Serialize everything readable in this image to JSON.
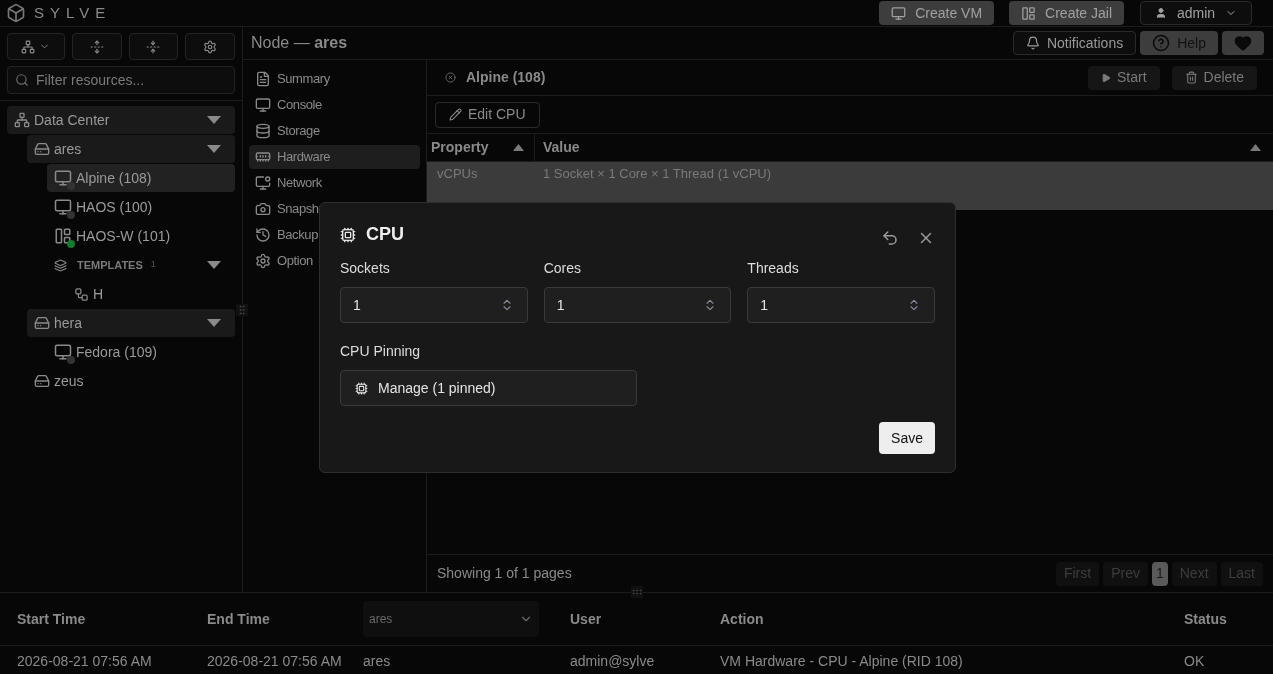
{
  "app": {
    "logo": "SYLVE"
  },
  "top_actions": [
    {
      "label": "Create VM",
      "kind": "vm"
    },
    {
      "label": "Create Jail",
      "kind": "jail"
    }
  ],
  "user_menu": {
    "label": "admin"
  },
  "sidebar": {
    "search": {
      "placeholder": "Filter resources..."
    },
    "tree": [
      {
        "label": "Data Center",
        "kind": "datacenter",
        "expanded": true,
        "children": [
          {
            "label": "ares",
            "kind": "node",
            "expanded": true,
            "children": [
              {
                "label": "Alpine (108)",
                "kind": "vm",
                "running": false,
                "selected": true
              },
              {
                "label": "HAOS (100)",
                "kind": "vm",
                "running": false,
                "selected": false
              },
              {
                "label": "HAOS-W (101)",
                "kind": "jail",
                "running": true,
                "selected": false
              },
              {
                "label": "TEMPLATES",
                "count": "1",
                "kind": "group",
                "expanded": true,
                "children": [
                  {
                    "label": "H",
                    "kind": "template"
                  }
                ]
              }
            ]
          },
          {
            "label": "hera",
            "kind": "node",
            "expanded": true,
            "children": [
              {
                "label": "Fedora (109)",
                "kind": "vm",
                "running": false,
                "selected": false
              }
            ]
          },
          {
            "label": "zeus",
            "kind": "node"
          }
        ]
      }
    ]
  },
  "header": {
    "title": "Node — **ares**"
  },
  "header_actions": [
    {
      "label": "Notifications",
      "kind": "bell"
    },
    {
      "label": "Help",
      "kind": "help"
    },
    {
      "kind": "heart"
    }
  ],
  "nav": [
    {
      "label": "Summary",
      "kind": "summary",
      "selected": false
    },
    {
      "label": "Console",
      "kind": "console",
      "selected": false
    },
    {
      "label": "Storage",
      "kind": "storage",
      "selected": false
    },
    {
      "label": "Hardware",
      "kind": "hardware",
      "selected": true
    },
    {
      "label": "Network",
      "kind": "network",
      "selected": false
    },
    {
      "label": "Snapsh",
      "kind": "snapshots",
      "selected": false
    },
    {
      "label": "Backup",
      "kind": "backups",
      "selected": false
    },
    {
      "label": "Option",
      "kind": "options",
      "selected": false
    }
  ],
  "vm_panel": {
    "title": "Alpine (108)",
    "actions": [
      {
        "label": "Start",
        "kind": "play"
      },
      {
        "label": "Delete",
        "kind": "trash"
      }
    ],
    "edit_button": "Edit CPU",
    "table": {
      "columns": [
        "Property",
        "Value"
      ],
      "rows": [
        {
          "cells": [
            "vCPUs",
            "1 Socket × 1 Core × 1 Thread (1 vCPU)"
          ],
          "selected": true
        },
        {
          "cells": [],
          "selected": true
        }
      ]
    },
    "pagination": {
      "summary": "Showing 1 of 1 pages",
      "buttons": [
        {
          "label": "First",
          "selected": false,
          "disabled": true
        },
        {
          "label": "Prev",
          "selected": false,
          "disabled": true
        },
        {
          "label": "1",
          "selected": true,
          "disabled": false
        },
        {
          "label": "Next",
          "selected": false,
          "disabled": true
        },
        {
          "label": "Last",
          "selected": false,
          "disabled": true
        }
      ]
    }
  },
  "dialog": {
    "title": "CPU",
    "fields": [
      {
        "label": "Sockets",
        "value": "1"
      },
      {
        "label": "Cores",
        "value": "1"
      },
      {
        "label": "Threads",
        "value": "1"
      }
    ],
    "pinning": {
      "label": "CPU Pinning",
      "button": "Manage (1 pinned)"
    },
    "save": "Save"
  },
  "log": {
    "columns": [
      {
        "kind": "text",
        "label": "Start Time"
      },
      {
        "kind": "text",
        "label": "End Time"
      },
      {
        "kind": "filter",
        "value": "ares"
      },
      {
        "kind": "text",
        "label": "User"
      },
      {
        "kind": "text",
        "label": "Action"
      },
      {
        "kind": "text",
        "label": "Status"
      }
    ],
    "rows": [
      [
        "2026-08-21 07:56 AM",
        "2026-08-21 07:56 AM",
        "ares",
        "admin@sylve",
        "VM Hardware - CPU - Alpine (RID 108)",
        "OK"
      ]
    ]
  }
}
